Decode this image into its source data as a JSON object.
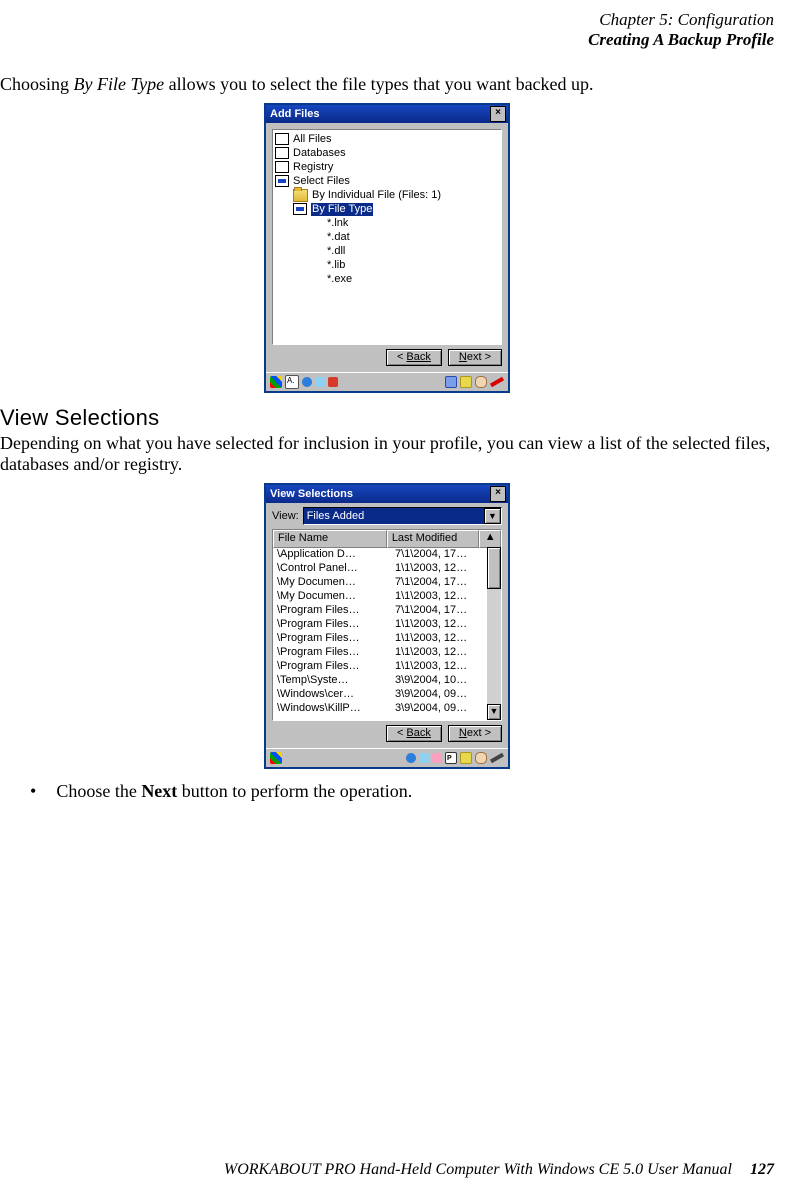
{
  "header": {
    "chapter": "Chapter 5: Configuration",
    "section": "Creating A Backup Profile"
  },
  "intro": {
    "lead": "Choosing ",
    "emph": "By File Type",
    "tail": " allows you to select the file types that you want backed up."
  },
  "dialog1": {
    "title": "Add Files",
    "items": {
      "all_files": "All Files",
      "databases": "Databases",
      "registry": "Registry",
      "select_files": "Select Files",
      "by_individual": "By Individual File (Files:   1)",
      "by_file_type": "By File Type",
      "ext_lnk": "*.lnk",
      "ext_dat": "*.dat",
      "ext_dll": "*.dll",
      "ext_lib": "*.lib",
      "ext_exe": "*.exe"
    },
    "back_label": "Back",
    "next_label": "Next >"
  },
  "sub1": {
    "heading": "View Selections",
    "para": "Depending on what you have selected for inclusion in your profile, you can view a list of the selected files, databases and/or registry."
  },
  "dialog2": {
    "title": "View Selections",
    "view_label": "View:",
    "view_value": "Files Added",
    "col_filename": "File Name",
    "col_lastmod": "Last Modified",
    "rows": [
      {
        "fn": "\\Application D…",
        "lm": "7\\1\\2004, 17…"
      },
      {
        "fn": "\\Control Panel…",
        "lm": "1\\1\\2003, 12…"
      },
      {
        "fn": "\\My Documen…",
        "lm": "7\\1\\2004, 17…"
      },
      {
        "fn": "\\My Documen…",
        "lm": "1\\1\\2003, 12…"
      },
      {
        "fn": "\\Program Files…",
        "lm": "7\\1\\2004, 17…"
      },
      {
        "fn": "\\Program Files…",
        "lm": "1\\1\\2003, 12…"
      },
      {
        "fn": "\\Program Files…",
        "lm": "1\\1\\2003, 12…"
      },
      {
        "fn": "\\Program Files…",
        "lm": "1\\1\\2003, 12…"
      },
      {
        "fn": "\\Program Files…",
        "lm": "1\\1\\2003, 12…"
      },
      {
        "fn": "\\Temp\\Syste…",
        "lm": "3\\9\\2004, 10…"
      },
      {
        "fn": "\\Windows\\cer…",
        "lm": "3\\9\\2004, 09…"
      },
      {
        "fn": "\\Windows\\KillP…",
        "lm": "3\\9\\2004, 09…"
      }
    ],
    "back_label": "Back",
    "next_label": "Next >"
  },
  "bullet": {
    "pre": "Choose the ",
    "bold": "Next",
    "post": " button to perform the operation."
  },
  "footer": {
    "text": "WORKABOUT PRO Hand-Held Computer With Windows CE 5.0 User Manual",
    "page": "127"
  }
}
